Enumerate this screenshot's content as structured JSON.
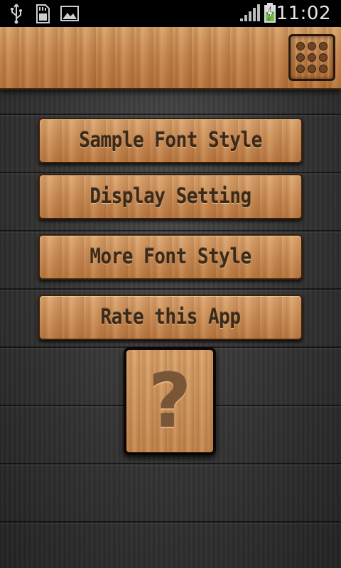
{
  "status_bar": {
    "time": "11:02",
    "icons": [
      "usb-icon",
      "sd-card-icon",
      "image-icon",
      "signal-icon",
      "battery-charging-icon"
    ]
  },
  "title_bar": {
    "menu_icon": "grid-menu-icon"
  },
  "menu": {
    "items": [
      {
        "label": "Sample Font Style"
      },
      {
        "label": "Display Setting"
      },
      {
        "label": "More Font Style"
      },
      {
        "label": "Rate this App"
      }
    ],
    "help_label": "?"
  },
  "colors": {
    "wood_light": "#dca771",
    "wood_dark": "#bb7b44",
    "text_dark": "#3a2a1c",
    "background": "#333333"
  }
}
